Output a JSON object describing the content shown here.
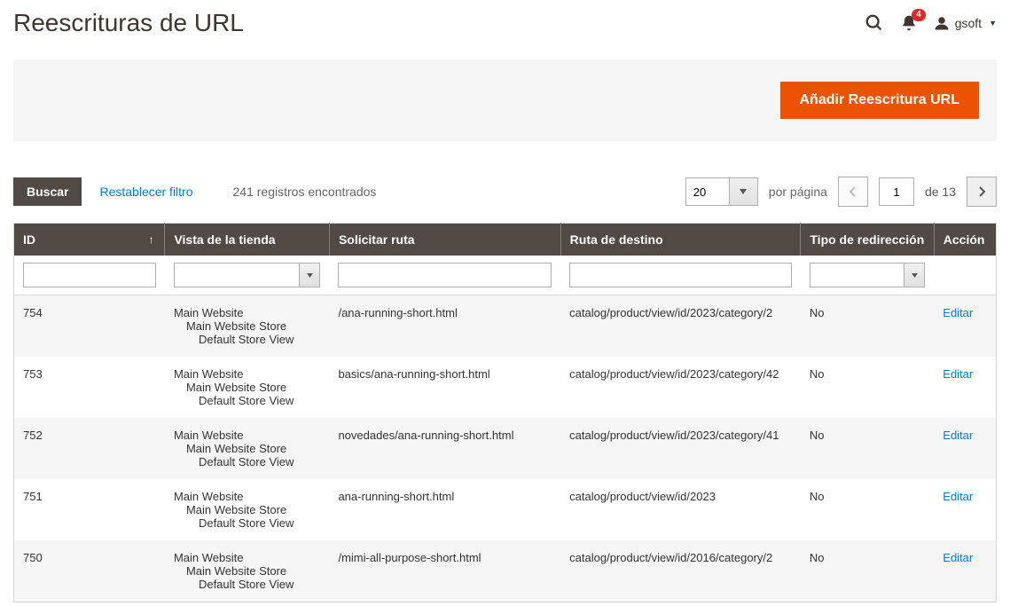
{
  "header": {
    "title": "Reescrituras de URL",
    "notifications_count": "4",
    "user_name": "gsoft"
  },
  "action_bar": {
    "add_label": "Añadir Reescritura URL"
  },
  "toolbar": {
    "search_label": "Buscar",
    "reset_label": "Restablecer filtro",
    "records_found": "241 registros encontrados",
    "per_page_value": "20",
    "per_page_label": "por página",
    "current_page": "1",
    "total_pages_label": "de 13"
  },
  "columns": {
    "id": "ID",
    "store": "Vista de la tienda",
    "request": "Solicitar ruta",
    "target": "Ruta de destino",
    "redirect": "Tipo de redirección",
    "action": "Acción"
  },
  "store_view": {
    "l0": "Main Website",
    "l1": "Main Website Store",
    "l2": "Default Store View"
  },
  "action_label": "Editar",
  "rows": [
    {
      "id": "754",
      "request": "/ana-running-short.html",
      "target": "catalog/product/view/id/2023/category/2",
      "redirect": "No"
    },
    {
      "id": "753",
      "request": "basics/ana-running-short.html",
      "target": "catalog/product/view/id/2023/category/42",
      "redirect": "No"
    },
    {
      "id": "752",
      "request": "novedades/ana-running-short.html",
      "target": "catalog/product/view/id/2023/category/41",
      "redirect": "No"
    },
    {
      "id": "751",
      "request": "ana-running-short.html",
      "target": "catalog/product/view/id/2023",
      "redirect": "No"
    },
    {
      "id": "750",
      "request": "/mimi-all-purpose-short.html",
      "target": "catalog/product/view/id/2016/category/2",
      "redirect": "No"
    }
  ]
}
